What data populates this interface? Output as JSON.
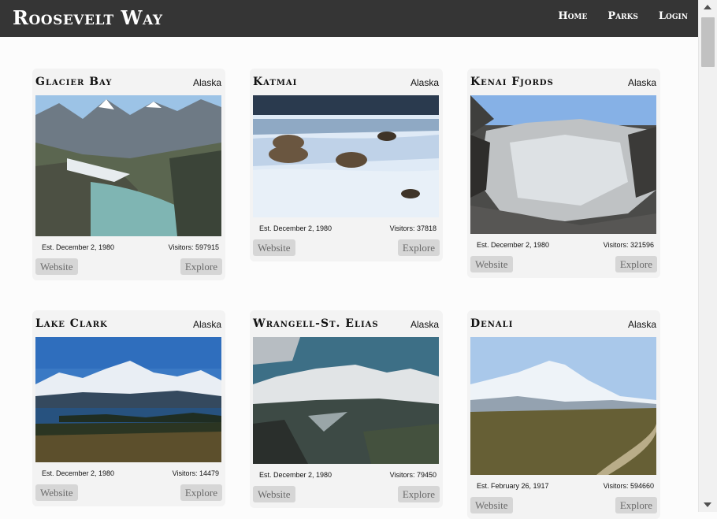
{
  "brand": "Roosevelt Way",
  "nav": {
    "home": "Home",
    "parks": "Parks",
    "login": "Login"
  },
  "cards": [
    {
      "name": "Glacier Bay",
      "state": "Alaska",
      "est": "Est. December 2, 1980",
      "visitors": "Visitors: 597915",
      "website": "Website",
      "explore": "Explore"
    },
    {
      "name": "Katmai",
      "state": "Alaska",
      "est": "Est. December 2, 1980",
      "visitors": "Visitors: 37818",
      "website": "Website",
      "explore": "Explore"
    },
    {
      "name": "Kenai Fjords",
      "state": "Alaska",
      "est": "Est. December 2, 1980",
      "visitors": "Visitors: 321596",
      "website": "Website",
      "explore": "Explore"
    },
    {
      "name": "Lake Clark",
      "state": "Alaska",
      "est": "Est. December 2, 1980",
      "visitors": "Visitors: 14479",
      "website": "Website",
      "explore": "Explore"
    },
    {
      "name": "Wrangell-St. Elias",
      "state": "Alaska",
      "est": "Est. December 2, 1980",
      "visitors": "Visitors: 79450",
      "website": "Website",
      "explore": "Explore"
    },
    {
      "name": "Denali",
      "state": "Alaska",
      "est": "Est. February 26, 1917",
      "visitors": "Visitors: 594660",
      "website": "Website",
      "explore": "Explore"
    }
  ]
}
